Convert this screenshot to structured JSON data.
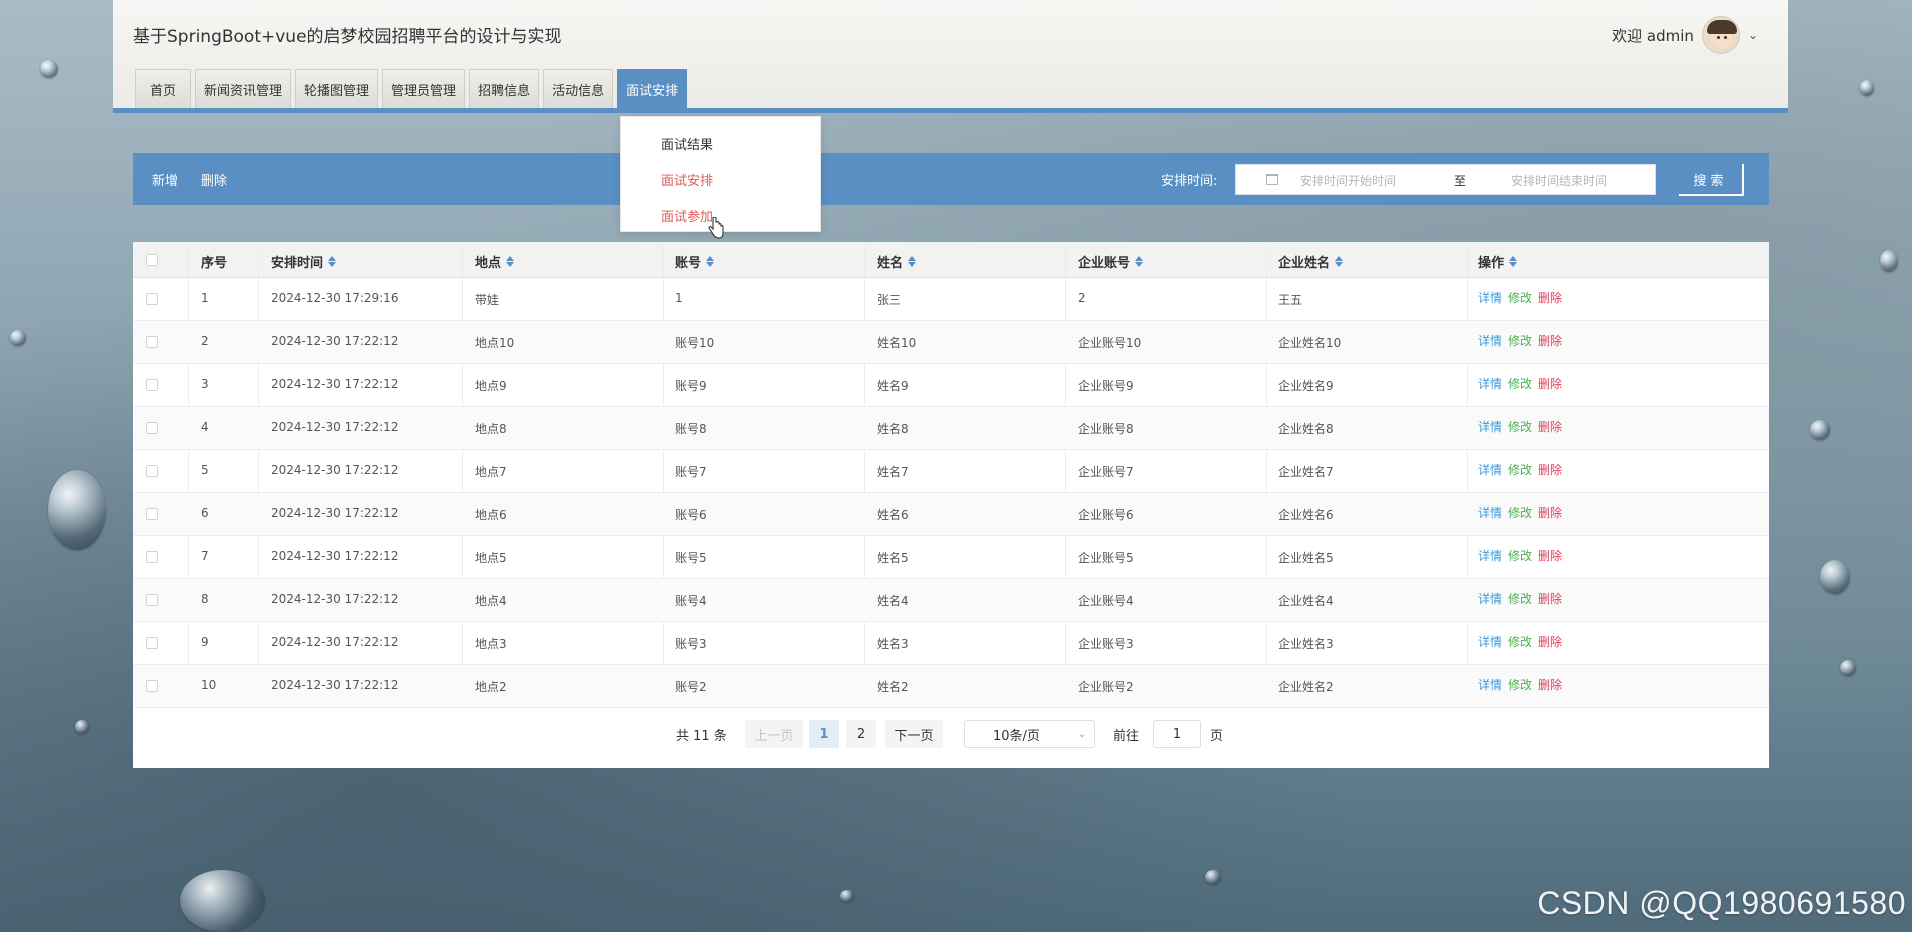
{
  "header": {
    "title": "基于SpringBoot+vue的启梦校园招聘平台的设计与实现",
    "user_greeting": "欢迎 admin"
  },
  "nav": {
    "tabs": [
      {
        "label": "首页"
      },
      {
        "label": "新闻资讯管理"
      },
      {
        "label": "轮播图管理"
      },
      {
        "label": "管理员管理"
      },
      {
        "label": "招聘信息"
      },
      {
        "label": "活动信息"
      },
      {
        "label": "面试安排",
        "active": true
      }
    ]
  },
  "dropdown": {
    "items": [
      {
        "label": "面试结果",
        "color": "#333333"
      },
      {
        "label": "面试安排",
        "color": "#e05a5a"
      },
      {
        "label": "面试参加",
        "color": "#e05a5a"
      }
    ]
  },
  "toolbar": {
    "add_label": "新增",
    "delete_label": "删除",
    "time_label": "安排时间:",
    "start_placeholder": "安排时间开始时间",
    "range_separator": "至",
    "end_placeholder": "安排时间结束时间",
    "search_label": "搜 索"
  },
  "table": {
    "columns": [
      "序号",
      "安排时间",
      "地点",
      "账号",
      "姓名",
      "企业账号",
      "企业姓名",
      "操作"
    ],
    "rows": [
      [
        "1",
        "2024-12-30 17:29:16",
        "带娃",
        "1",
        "张三",
        "2",
        "王五"
      ],
      [
        "2",
        "2024-12-30 17:22:12",
        "地点10",
        "账号10",
        "姓名10",
        "企业账号10",
        "企业姓名10"
      ],
      [
        "3",
        "2024-12-30 17:22:12",
        "地点9",
        "账号9",
        "姓名9",
        "企业账号9",
        "企业姓名9"
      ],
      [
        "4",
        "2024-12-30 17:22:12",
        "地点8",
        "账号8",
        "姓名8",
        "企业账号8",
        "企业姓名8"
      ],
      [
        "5",
        "2024-12-30 17:22:12",
        "地点7",
        "账号7",
        "姓名7",
        "企业账号7",
        "企业姓名7"
      ],
      [
        "6",
        "2024-12-30 17:22:12",
        "地点6",
        "账号6",
        "姓名6",
        "企业账号6",
        "企业姓名6"
      ],
      [
        "7",
        "2024-12-30 17:22:12",
        "地点5",
        "账号5",
        "姓名5",
        "企业账号5",
        "企业姓名5"
      ],
      [
        "8",
        "2024-12-30 17:22:12",
        "地点4",
        "账号4",
        "姓名4",
        "企业账号4",
        "企业姓名4"
      ],
      [
        "9",
        "2024-12-30 17:22:12",
        "地点3",
        "账号3",
        "姓名3",
        "企业账号3",
        "企业姓名3"
      ],
      [
        "10",
        "2024-12-30 17:22:12",
        "地点2",
        "账号2",
        "姓名2",
        "企业账号2",
        "企业姓名2"
      ]
    ],
    "actions": {
      "detail": {
        "label": "详情",
        "color": "#3a9ad9"
      },
      "edit": {
        "label": "修改",
        "color": "#4caf50"
      },
      "delete": {
        "label": "删除",
        "color": "#e0405a"
      }
    }
  },
  "pagination": {
    "total": "共 11 条",
    "prev": "上一页",
    "pages": [
      "1",
      "2"
    ],
    "current": "1",
    "next": "下一页",
    "page_size": "10条/页",
    "goto_label": "前往",
    "goto_value": "1",
    "page_suffix": "页"
  },
  "watermark": "CSDN @QQ1980691580",
  "colors": {
    "accent": "#5a8fc4"
  }
}
